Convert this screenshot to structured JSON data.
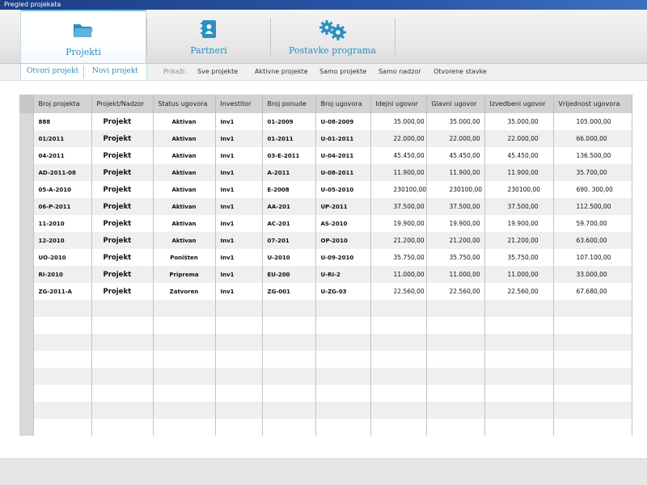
{
  "window": {
    "title": "Pregled projekata"
  },
  "tabs": [
    {
      "label": "Projekti",
      "icon": "folder-icon",
      "active": true
    },
    {
      "label": "Partneri",
      "icon": "contacts-book-icon",
      "active": false
    },
    {
      "label": "Postavke programa",
      "icon": "gears-icon",
      "active": false
    }
  ],
  "subnav": {
    "actions": [
      "Otvori projekt",
      "Novi projekt"
    ],
    "show_label": "Prikaži:",
    "filters": [
      "Sve projekte",
      "Aktivne projekte",
      "Samo projekte",
      "Samo nadzor",
      "Otvorene stavke"
    ]
  },
  "colors": {
    "accent": "#2c8fc1",
    "titlebar": "#1c3f86",
    "header": "#d2d2d2",
    "row_alt": "#efefef"
  },
  "grid": {
    "columns": [
      "Broj projekta",
      "Projekt/Nadzor",
      "Status ugovora",
      "Investitor",
      "Broj ponude",
      "Broj ugovora",
      "Idejni ugovor",
      "Glavni ugovor",
      "Izvedbeni ugovor",
      "Vrijednost ugovora"
    ],
    "rows": [
      [
        "888",
        "Projekt",
        "Aktivan",
        "Inv1",
        "01-2009",
        "U-08-2009",
        "35.000,00",
        "35.000,00",
        "35.000,00",
        "105.000,00"
      ],
      [
        "01/2011",
        "Projekt",
        "Aktivan",
        "Inv1",
        "01-2011",
        "U-01-2011",
        "22.000,00",
        "22.000,00",
        "22.000,00",
        "66.000,00"
      ],
      [
        "04-2011",
        "Projekt",
        "Aktivan",
        "Inv1",
        "03-E-2011",
        "U-04-2011",
        "45.450,00",
        "45.450,00",
        "45.450,00",
        "136.500,00"
      ],
      [
        "AD-2011-08",
        "Projekt",
        "Aktivan",
        "Inv1",
        "A-2011",
        "U-08-2011",
        "11.900,00",
        "11.900,00",
        "11.900,00",
        "35.700,00"
      ],
      [
        "05-A-2010",
        "Projekt",
        "Aktivan",
        "Inv1",
        "E-2008",
        "U-05-2010",
        "230100,00",
        "230100,00",
        "230100,00",
        "690. 300,00"
      ],
      [
        "06-P-2011",
        "Projekt",
        "Aktivan",
        "Inv1",
        "AA-201",
        "UP-2011",
        "37.500,00",
        "37.500,00",
        "37.500,00",
        "112.500,00"
      ],
      [
        "11-2010",
        "Projekt",
        "Aktivan",
        "Inv1",
        "AC-201",
        "AS-2010",
        "19.900,00",
        "19.900,00",
        "19.900,00",
        "59.700,00"
      ],
      [
        "12-2010",
        "Projekt",
        "Aktivan",
        "Inv1",
        "07-201",
        "OP-2010",
        "21.200,00",
        "21.200,00",
        "21.200,00",
        "63.600,00"
      ],
      [
        "UO-2010",
        "Projekt",
        "Poništen",
        "Inv1",
        "U-2010",
        "U-09-2010",
        "35.750,00",
        "35.750,00",
        "35.750,00",
        "107.100,00"
      ],
      [
        "RI-2010",
        "Projekt",
        "Priprema",
        "Inv1",
        "EU-200",
        "U-RI-2",
        "11.000,00",
        "11.000,00",
        "11.000,00",
        "33.000,00"
      ],
      [
        "ZG-2011-A",
        "Projekt",
        "Zatvoren",
        "Inv1",
        "ZG-001",
        "U-ZG-03",
        "22.560,00",
        "22.560,00",
        "22.560,00",
        "67.680,00"
      ]
    ],
    "empty_rows": 8
  }
}
